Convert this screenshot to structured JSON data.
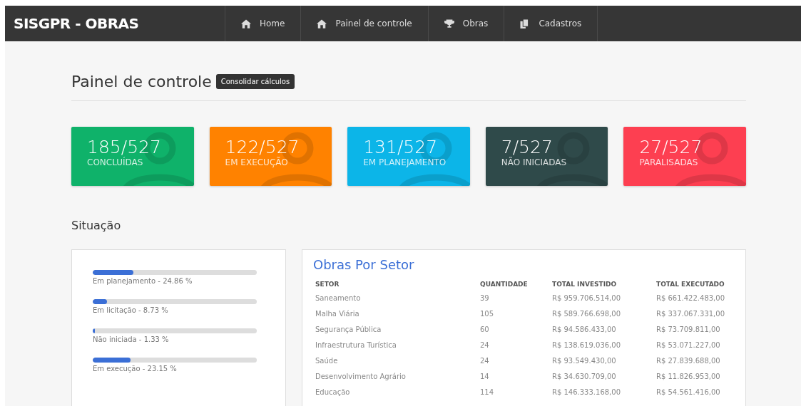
{
  "brand": "SISGPR - OBRAS",
  "nav": [
    {
      "label": "Home"
    },
    {
      "label": "Painel de controle"
    },
    {
      "label": "Obras"
    },
    {
      "label": "Cadastros"
    }
  ],
  "page_title": "Painel de controle",
  "action_button": "Consolidar cálculos",
  "stats": [
    {
      "value": "185/527",
      "label": "CONCLUÍDAS",
      "color": "#0fb26a"
    },
    {
      "value": "122/527",
      "label": "EM EXECUÇÃO",
      "color": "#ff8200"
    },
    {
      "value": "131/527",
      "label": "EM PLANEJAMENTO",
      "color": "#0cb5e8"
    },
    {
      "value": "7/527",
      "label": "NÃO INICIADAS",
      "color": "#2f4a4a"
    },
    {
      "value": "27/527",
      "label": "PARALISADAS",
      "color": "#fd3f51"
    }
  ],
  "section_title": "Situação",
  "progress": [
    {
      "label": "Em planejamento - 24.86 %",
      "level": 0.2486
    },
    {
      "label": "Em licitação - 8.73 %",
      "level": 0.0873
    },
    {
      "label": "Não iniciada - 1.33 %",
      "level": 0.0133
    },
    {
      "label": "Em execução - 23.15 %",
      "level": 0.2315
    }
  ],
  "table": {
    "title": "Obras Por Setor",
    "columns": [
      "SETOR",
      "QUANTIDADE",
      "TOTAL INVESTIDO",
      "TOTAL EXECUTADO"
    ],
    "rows": [
      [
        "Saneamento",
        "39",
        "R$ 959.706.514,00",
        "R$ 661.422.483,00"
      ],
      [
        "Malha Viária",
        "105",
        "R$ 589.766.698,00",
        "R$ 337.067.331,00"
      ],
      [
        "Segurança Pública",
        "60",
        "R$ 94.586.433,00",
        "R$ 73.709.811,00"
      ],
      [
        "Infraestrutura Turística",
        "24",
        "R$ 138.619.036,00",
        "R$ 53.071.227,00"
      ],
      [
        "Saúde",
        "24",
        "R$ 93.549.430,00",
        "R$ 27.839.688,00"
      ],
      [
        "Desenvolvimento Agrário",
        "14",
        "R$ 34.630.709,00",
        "R$ 11.826.953,00"
      ],
      [
        "Educação",
        "114",
        "R$ 146.333.168,00",
        "R$ 54.561.416,00"
      ]
    ]
  }
}
